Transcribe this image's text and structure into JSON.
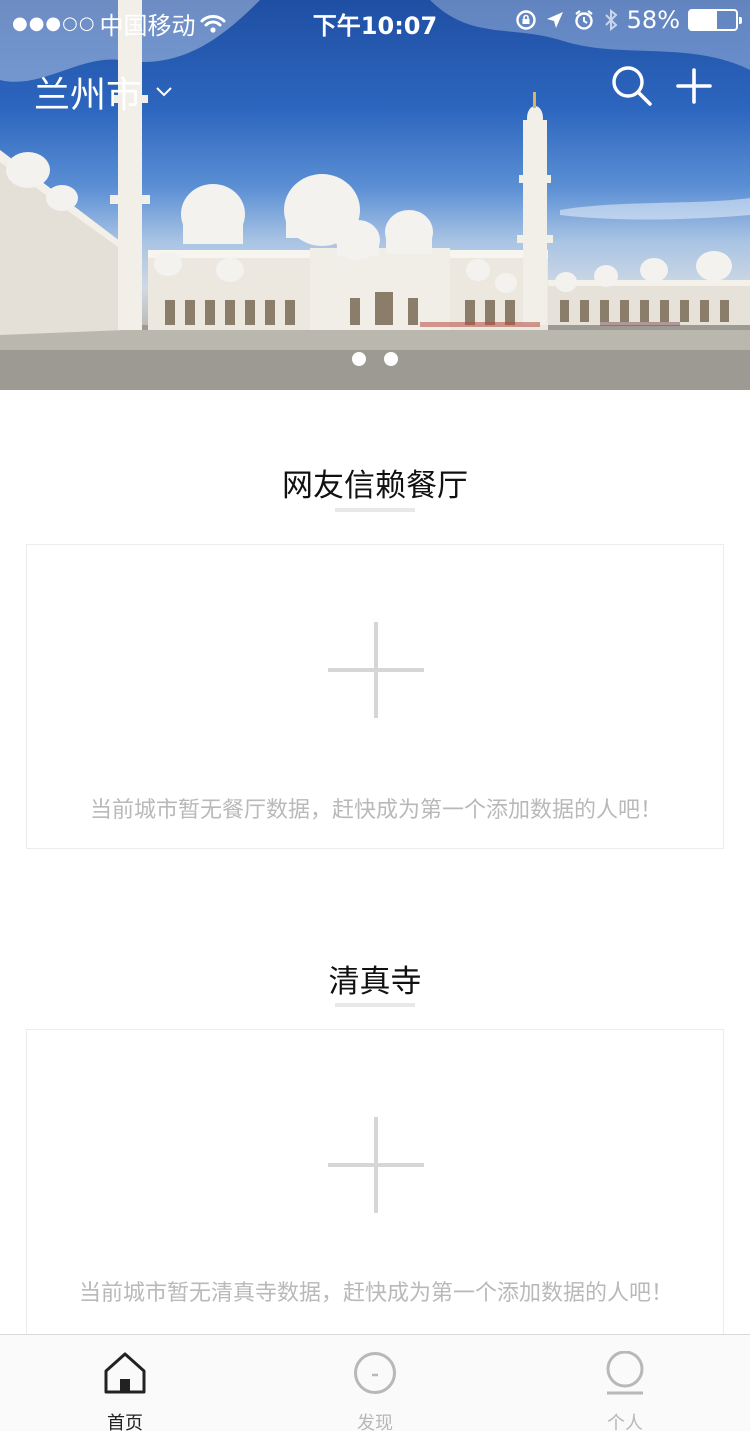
{
  "status_bar": {
    "signal": "●●●○○",
    "carrier": "中国移动",
    "time": "下午10:07",
    "battery_text": "58%",
    "battery_level": 0.58
  },
  "header": {
    "city": "兰州市"
  },
  "banner": {
    "pager_count": 2
  },
  "sections": [
    {
      "title": "网友信赖餐厅",
      "empty_text": "当前城市暂无餐厅数据，赶快成为第一个添加数据的人吧！"
    },
    {
      "title": "清真寺",
      "empty_text": "当前城市暂无清真寺数据，赶快成为第一个添加数据的人吧！"
    }
  ],
  "tabbar": {
    "tabs": [
      {
        "label": "首页",
        "icon": "home-icon",
        "active": true
      },
      {
        "label": "发现",
        "icon": "discover-icon",
        "active": false
      },
      {
        "label": "个人",
        "icon": "profile-icon",
        "active": false
      }
    ]
  },
  "colors": {
    "active_tab": "#222222",
    "inactive_tab": "#b8b8b8",
    "empty_text": "#b9b9b9",
    "plus_gray": "#d6d6d6"
  }
}
